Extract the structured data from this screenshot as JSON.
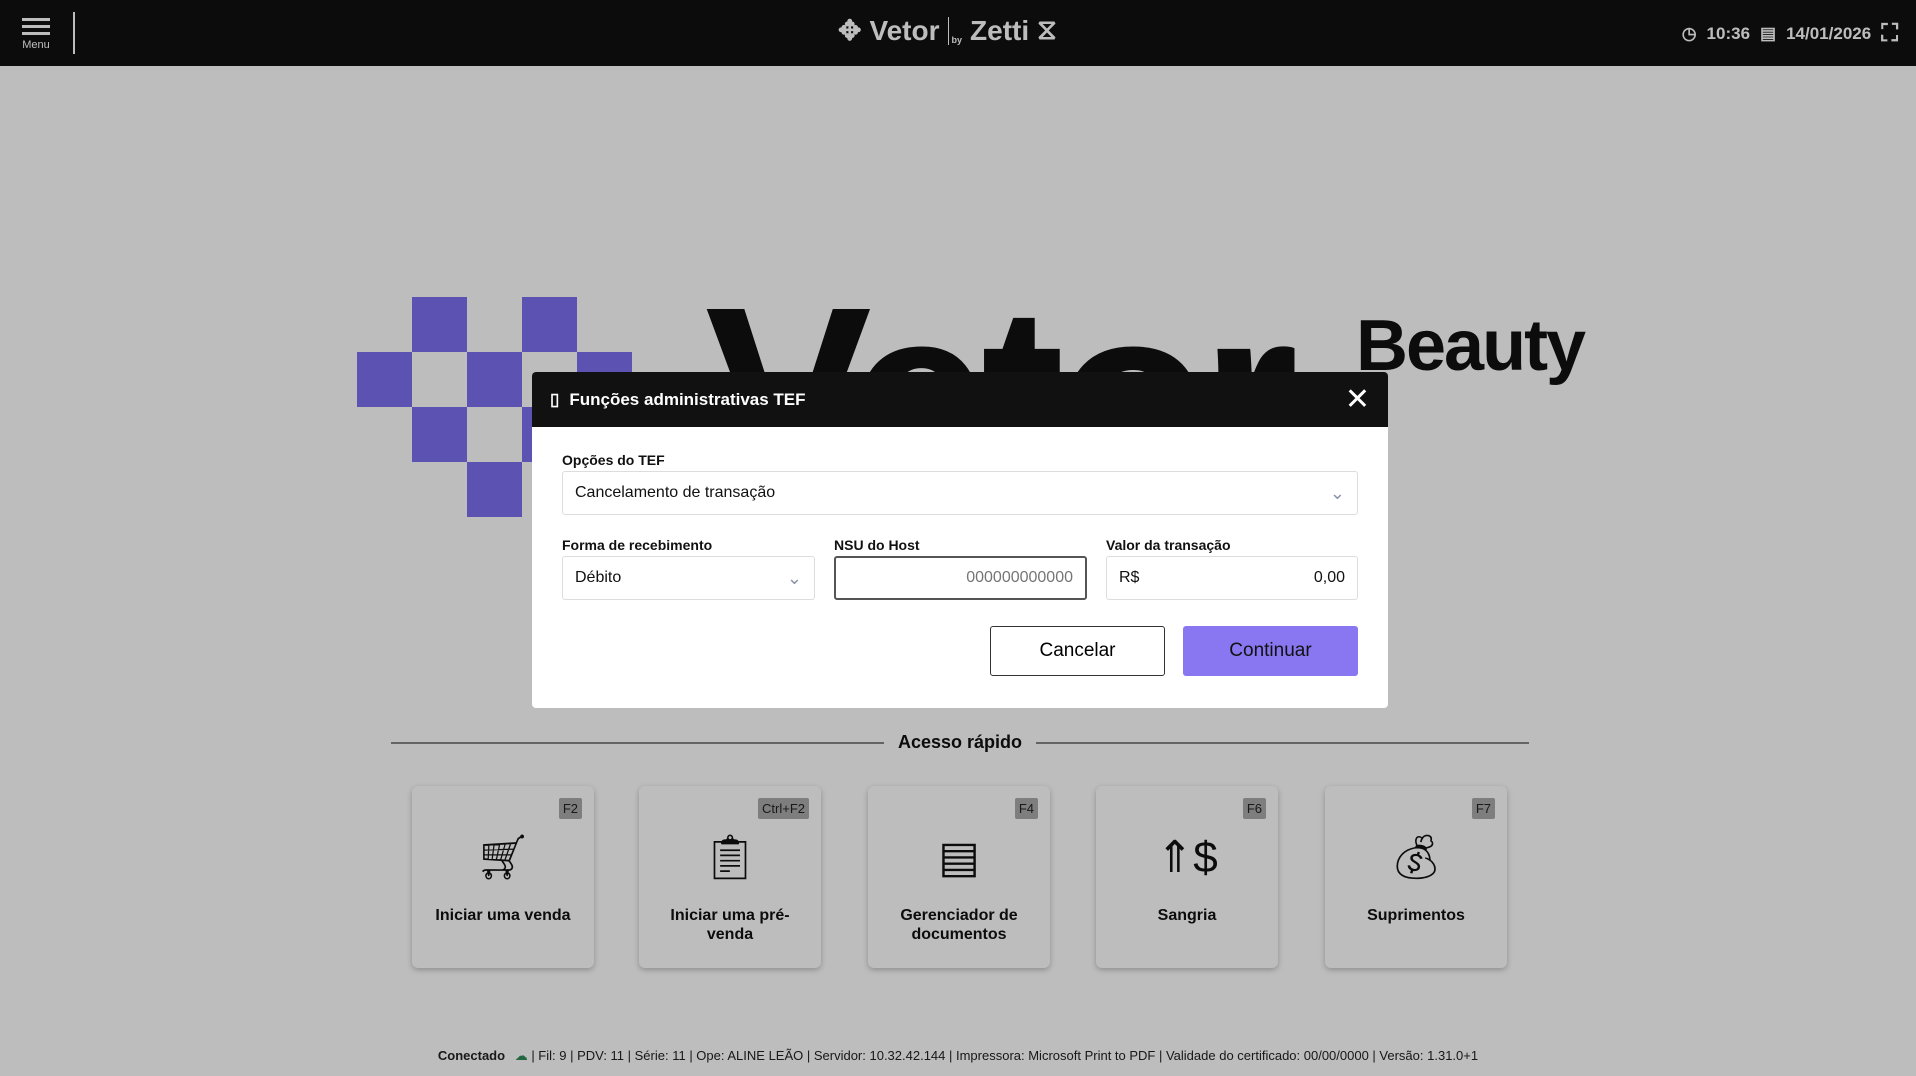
{
  "header": {
    "menu_label": "Menu",
    "brand_left": "Vetor",
    "brand_by": "by",
    "brand_right": "Zetti",
    "time": "10:36",
    "date": "14/01/2026"
  },
  "background": {
    "logo_text": "Vetor",
    "subtitle": "Beauty",
    "accent": "#7d6ff0"
  },
  "quick_access": {
    "title": "Acesso rápido",
    "cards": [
      {
        "key": "F2",
        "label": "Iniciar uma venda",
        "icon": "cart-icon"
      },
      {
        "key": "Ctrl+F2",
        "label": "Iniciar uma pré-venda",
        "icon": "clipboard-cart-icon"
      },
      {
        "key": "F4",
        "label": "Gerenciador de documentos",
        "icon": "document-icon"
      },
      {
        "key": "F6",
        "label": "Sangria",
        "icon": "arrows-dollar-icon"
      },
      {
        "key": "F7",
        "label": "Suprimentos",
        "icon": "money-bag-icon"
      }
    ]
  },
  "footer": {
    "status": "Conectado",
    "status_color": "#2e8b57",
    "info": "| Fil: 9 | PDV: 11 | Série: 11 | Ope: ALINE LEÃO | Servidor: 10.32.42.144 | Impressora: Microsoft Print to PDF | Validade do certificado: 00/00/0000 | Versão: 1.31.0+1"
  },
  "modal": {
    "title": "Funções administrativas TEF",
    "tef_options_label": "Opções do TEF",
    "tef_options_value": "Cancelamento de transação",
    "payment_label": "Forma de recebimento",
    "payment_value": "Débito",
    "nsu_label": "NSU do Host",
    "nsu_placeholder": "000000000000",
    "amount_label": "Valor da transação",
    "amount_prefix": "R$",
    "amount_value": "0,00",
    "cancel_label": "Cancelar",
    "continue_label": "Continuar",
    "continue_color": "#8877f0"
  }
}
